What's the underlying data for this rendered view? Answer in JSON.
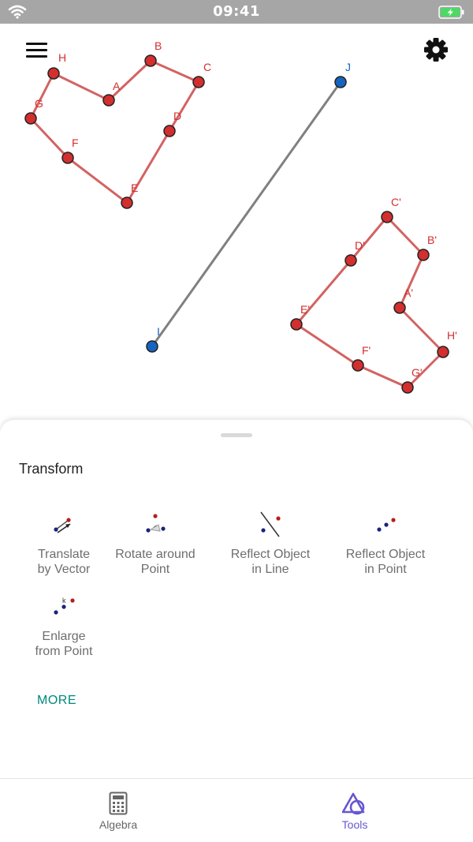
{
  "status_bar": {
    "time": "09:41"
  },
  "canvas": {
    "points": {
      "A": "A",
      "B": "B",
      "C": "C",
      "D": "D",
      "E": "E",
      "F": "F",
      "G": "G",
      "H": "H",
      "A1": "A'",
      "B1": "B'",
      "C1": "C'",
      "D1": "D'",
      "E1": "E'",
      "F1": "F'",
      "G1": "G'",
      "H1": "H'",
      "I": "I",
      "J": "J"
    },
    "colors": {
      "polygon_stroke": "#d36363",
      "point_fill": "#d32f2f",
      "line_point_fill": "#1565c0",
      "mirror_line": "#808080",
      "label_red": "#d32f2f",
      "label_blue": "#1565c0"
    }
  },
  "toolbar": {
    "menu_icon": "hamburger-menu-icon",
    "settings_icon": "gear-icon"
  },
  "sheet": {
    "title": "Transform",
    "tools": [
      {
        "id": "translate",
        "label": "Translate\nby Vector",
        "icon": "translate-vector-icon"
      },
      {
        "id": "rotate",
        "label": "Rotate around\nPoint",
        "icon": "rotate-point-icon"
      },
      {
        "id": "reflect-line",
        "label": "Reflect Object\nin Line",
        "icon": "reflect-line-icon"
      },
      {
        "id": "reflect-point",
        "label": "Reflect Object\nin Point",
        "icon": "reflect-point-icon"
      },
      {
        "id": "enlarge",
        "label": "Enlarge\nfrom Point",
        "icon": "dilate-point-icon",
        "icon_text": "k"
      }
    ],
    "more_label": "MORE"
  },
  "tabbar": {
    "tabs": [
      {
        "id": "algebra",
        "label": "Algebra",
        "icon": "calculator-icon",
        "active": false
      },
      {
        "id": "tools",
        "label": "Tools",
        "icon": "tools-shapes-icon",
        "active": true
      }
    ],
    "active_color": "#6557d2"
  }
}
